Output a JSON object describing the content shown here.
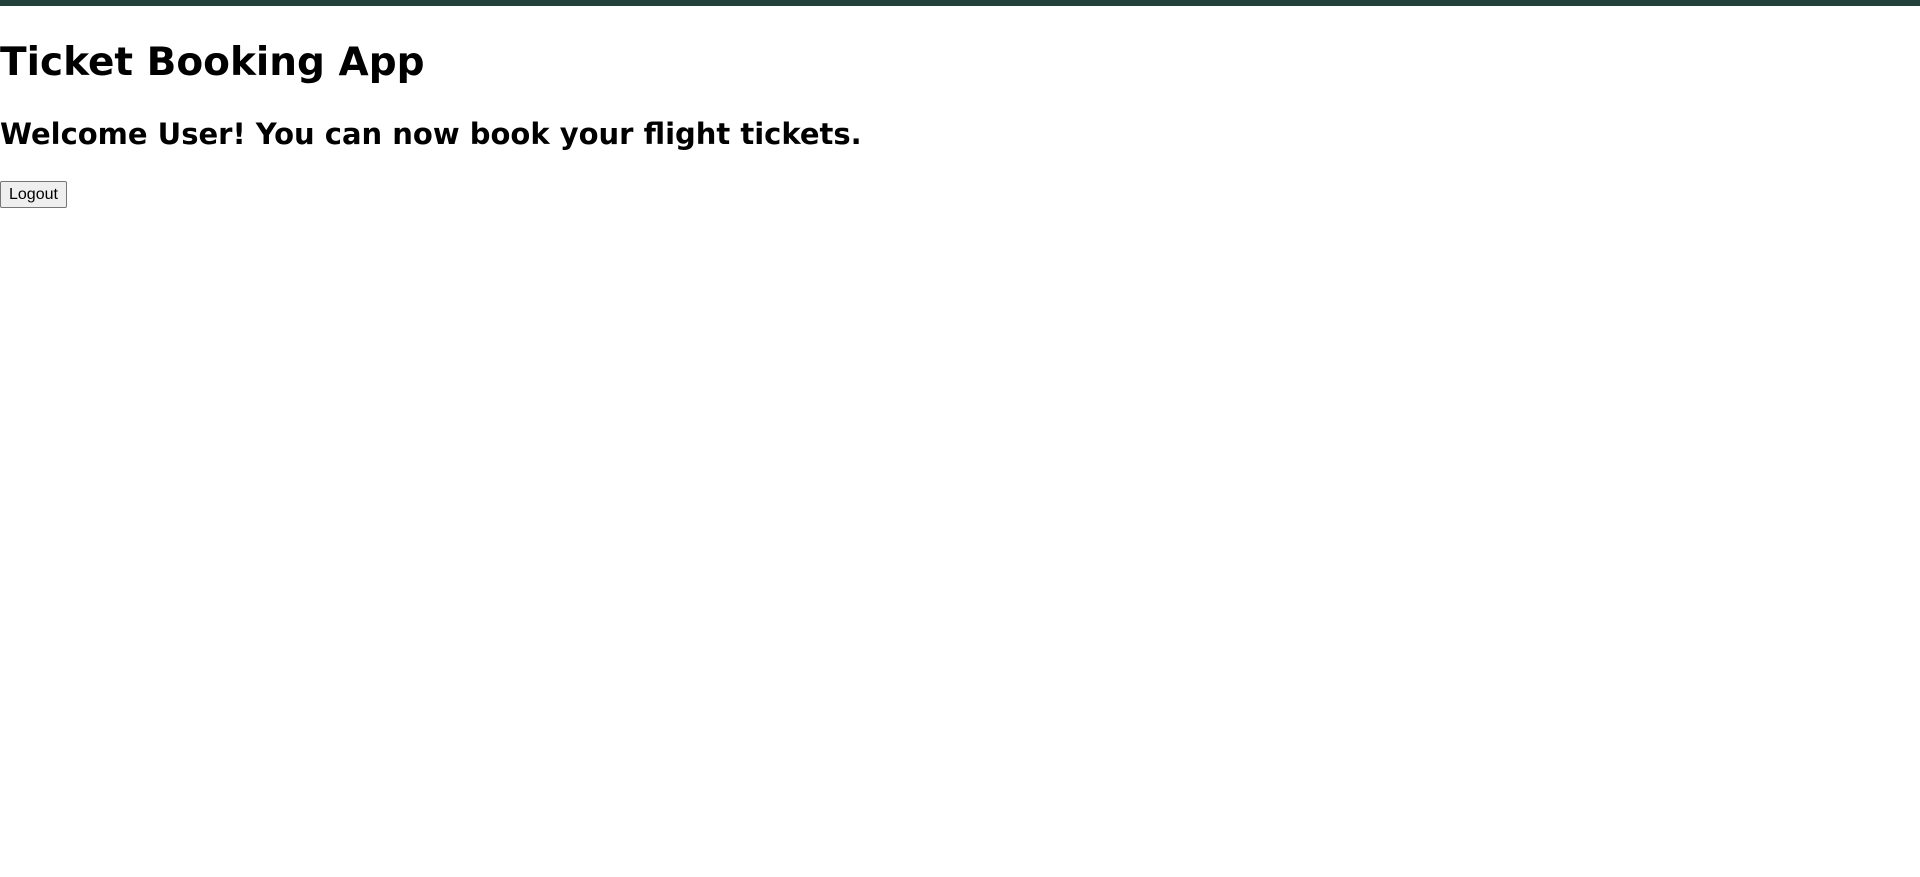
{
  "colors": {
    "top_bar": "#22413b",
    "background": "#ffffff",
    "text": "#000000"
  },
  "header": {
    "title": "Ticket Booking App"
  },
  "main": {
    "welcome_message": "Welcome User! You can now book your flight tickets.",
    "logout_label": "Logout"
  }
}
